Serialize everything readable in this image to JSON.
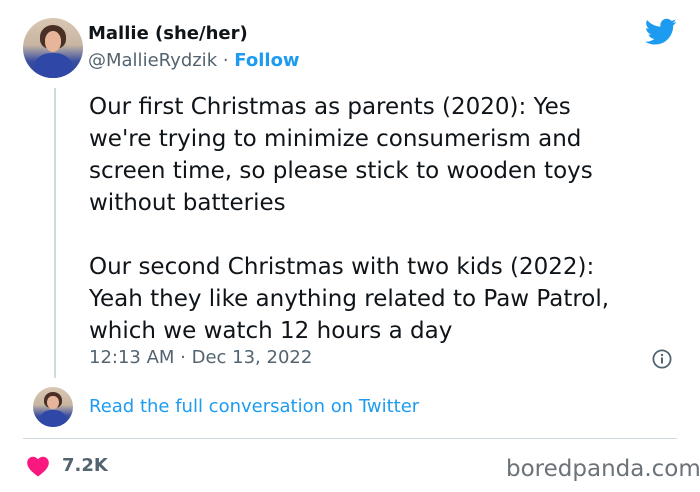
{
  "author": {
    "name": "Mallie (she/her)",
    "handle": "@MallieRydzik",
    "separator": " · ",
    "follow_label": "Follow"
  },
  "tweet": {
    "text": "Our first Christmas as parents (2020): Yes\nwe're trying to minimize consumerism and\nscreen time, so please stick to wooden toys\nwithout batteries\n\nOur second Christmas with two kids (2022):\nYeah they like anything related to Paw Patrol,\nwhich we watch 12 hours a day",
    "timestamp": "12:13 AM · Dec 13, 2022"
  },
  "thread": {
    "read_link": "Read the full conversation on Twitter"
  },
  "engagement": {
    "likes": "7.2K"
  },
  "watermark": "boredpanda.com",
  "icons": {
    "bird": "twitter-bird-icon",
    "info": "info-icon",
    "heart": "heart-icon"
  },
  "colors": {
    "accent": "#1d9bf0",
    "heart": "#f91880",
    "muted": "#536471"
  }
}
